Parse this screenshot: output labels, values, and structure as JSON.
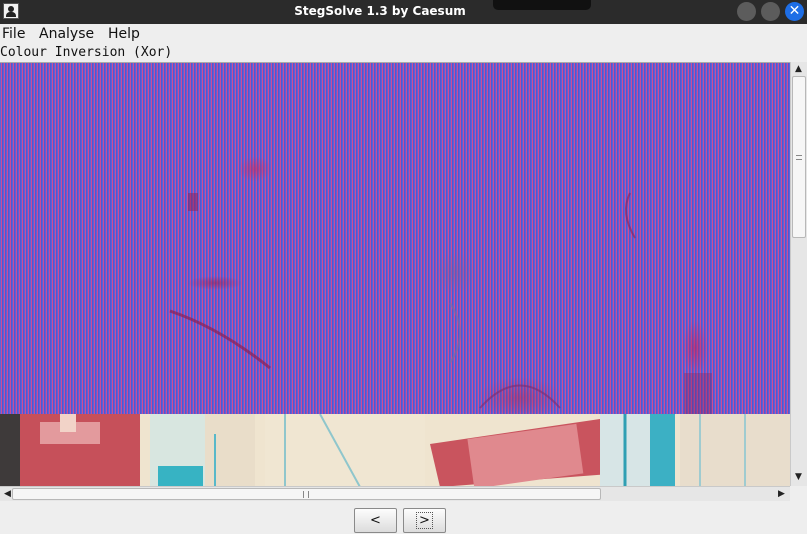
{
  "window": {
    "title": "StegSolve 1.3 by Caesum",
    "icon": "stegsolve-app-icon",
    "controls": [
      "minimize-icon",
      "maximize-icon",
      "close-icon"
    ],
    "close_glyph": "✕"
  },
  "menu": {
    "items": [
      {
        "label": "File"
      },
      {
        "label": "Analyse"
      },
      {
        "label": "Help"
      }
    ]
  },
  "viewer": {
    "transform_label": "Colour Inversion (Xor)"
  },
  "scrollbars": {
    "vertical_up_glyph": "▲",
    "vertical_down_glyph": "▼",
    "horizontal_left_glyph": "◀",
    "horizontal_right_glyph": "▶"
  },
  "navigation": {
    "prev_label": "<",
    "next_label": ">"
  },
  "colors": {
    "xor_blue": "#5e63d6",
    "xor_magenta": "#cc4d96",
    "titlebar": "#2b2b2b",
    "close_button": "#1e6ee6"
  }
}
